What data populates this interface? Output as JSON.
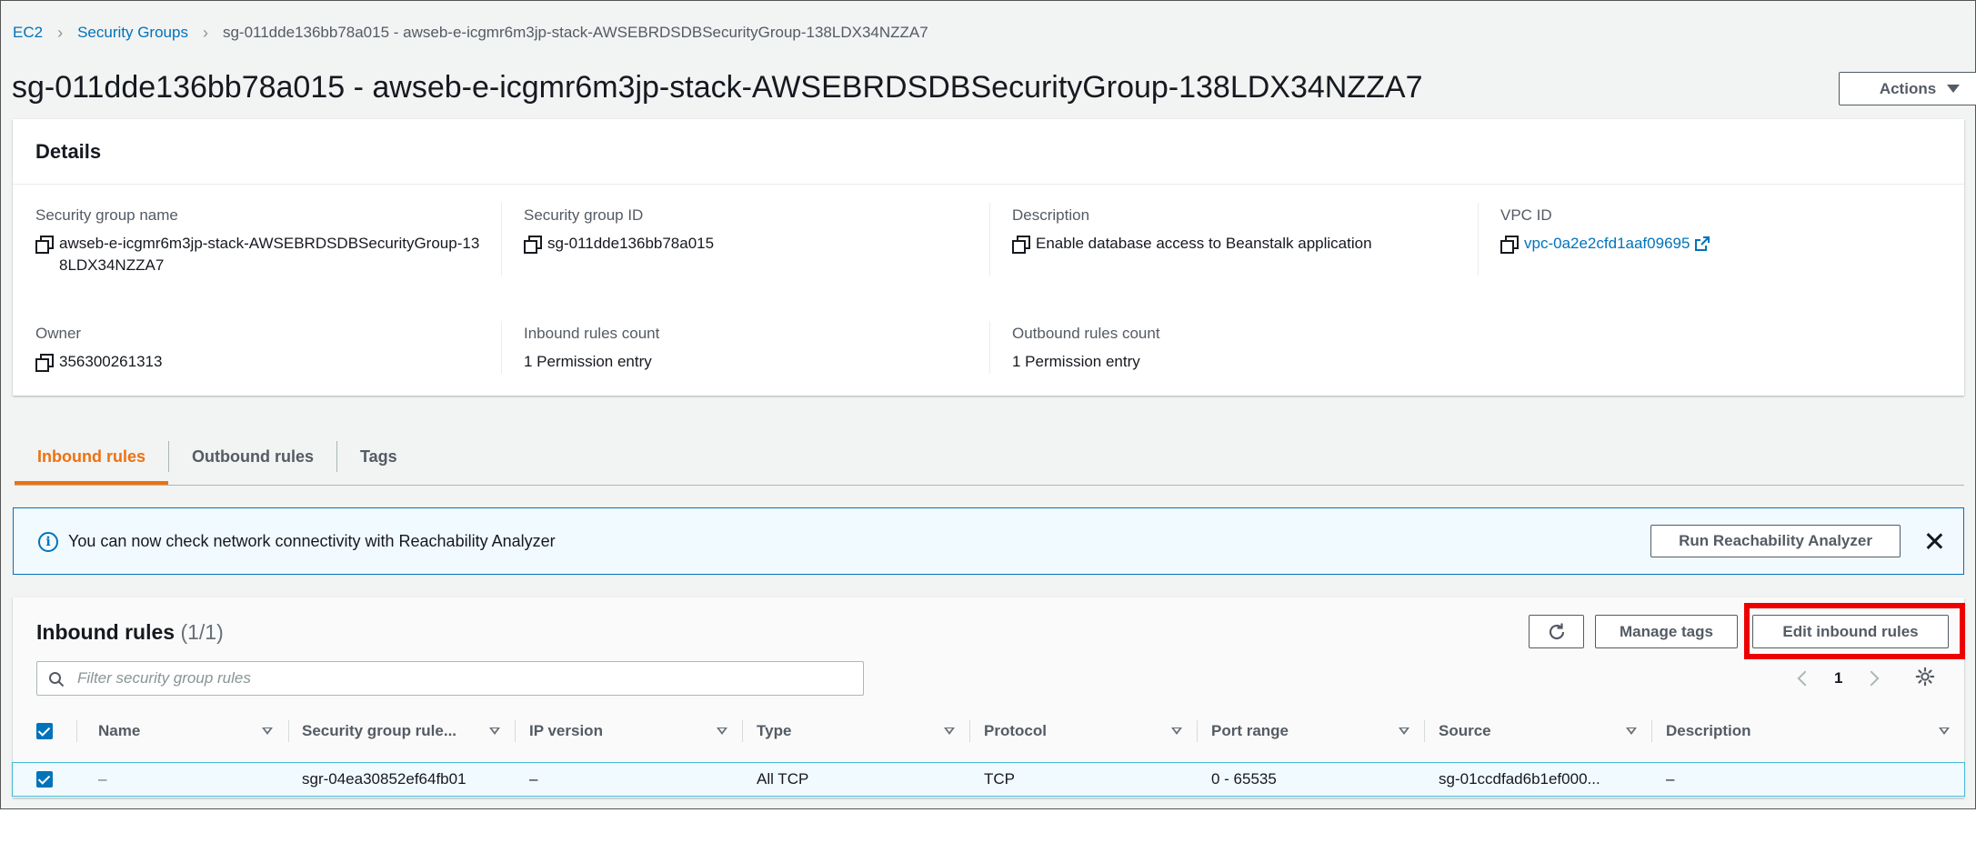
{
  "breadcrumb": {
    "items": [
      "EC2",
      "Security Groups"
    ],
    "current": "sg-011dde136bb78a015 - awseb-e-icgmr6m3jp-stack-AWSEBRDSDBSecurityGroup-138LDX34NZZA7"
  },
  "page_title": "sg-011dde136bb78a015 - awseb-e-icgmr6m3jp-stack-AWSEBRDSDBSecurityGroup-138LDX34NZZA7",
  "actions_label": "Actions",
  "details": {
    "title": "Details",
    "fields": {
      "sg_name": {
        "label": "Security group name",
        "value": "awseb-e-icgmr6m3jp-stack-AWSEBRDSDBSecurityGroup-138LDX34NZZA7"
      },
      "sg_id": {
        "label": "Security group ID",
        "value": "sg-011dde136bb78a015"
      },
      "description": {
        "label": "Description",
        "value": "Enable database access to Beanstalk application"
      },
      "vpc_id": {
        "label": "VPC ID",
        "value": "vpc-0a2e2cfd1aaf09695"
      },
      "owner": {
        "label": "Owner",
        "value": "356300261313"
      },
      "inbound_count": {
        "label": "Inbound rules count",
        "value": "1 Permission entry"
      },
      "outbound_count": {
        "label": "Outbound rules count",
        "value": "1 Permission entry"
      }
    }
  },
  "tabs": [
    {
      "label": "Inbound rules",
      "active": true
    },
    {
      "label": "Outbound rules",
      "active": false
    },
    {
      "label": "Tags",
      "active": false
    }
  ],
  "alert": {
    "text": "You can now check network connectivity with Reachability Analyzer",
    "button_label": "Run Reachability Analyzer"
  },
  "inbound_rules": {
    "title": "Inbound rules",
    "count": "(1/1)",
    "manage_tags_label": "Manage tags",
    "edit_label": "Edit inbound rules",
    "filter_placeholder": "Filter security group rules",
    "page": "1",
    "columns": [
      "Name",
      "Security group rule...",
      "IP version",
      "Type",
      "Protocol",
      "Port range",
      "Source",
      "Description"
    ],
    "rows": [
      {
        "name": "–",
        "rule_id": "sgr-04ea30852ef64fb01",
        "ip_version": "–",
        "type": "All TCP",
        "protocol": "TCP",
        "port_range": "0 - 65535",
        "source": "sg-01ccdfad6b1ef000...",
        "description": "–"
      }
    ]
  },
  "colors": {
    "link": "#0073bb",
    "active_tab": "#ec7211",
    "highlight": "#ee0000",
    "alert_bg": "#f1faff"
  }
}
